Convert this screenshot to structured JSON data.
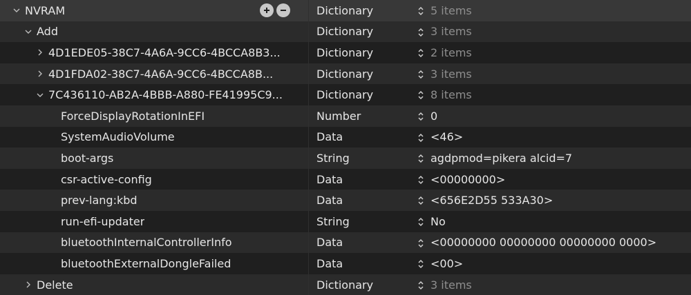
{
  "rows": [
    {
      "key": "NVRAM",
      "type": "Dictionary",
      "value": "5 items",
      "level": 0,
      "disclosure": "open",
      "controls": true,
      "dim": true,
      "style": "sel"
    },
    {
      "key": "Add",
      "type": "Dictionary",
      "value": "3 items",
      "level": 1,
      "disclosure": "open",
      "dim": true,
      "style": "alt"
    },
    {
      "key": "4D1EDE05-38C7-4A6A-9CC6-4BCCA8B3...",
      "type": "Dictionary",
      "value": "2 items",
      "level": 2,
      "disclosure": "closed",
      "dim": true,
      "style": ""
    },
    {
      "key": "4D1FDA02-38C7-4A6A-9CC6-4BCCA8B...",
      "type": "Dictionary",
      "value": "3 items",
      "level": 2,
      "disclosure": "closed",
      "dim": true,
      "style": "alt"
    },
    {
      "key": "7C436110-AB2A-4BBB-A880-FE41995C9...",
      "type": "Dictionary",
      "value": "8 items",
      "level": 2,
      "disclosure": "open",
      "dim": true,
      "style": ""
    },
    {
      "key": "ForceDisplayRotationInEFI",
      "type": "Number",
      "value": "0",
      "level": 3,
      "disclosure": "none",
      "dim": false,
      "style": "alt"
    },
    {
      "key": "SystemAudioVolume",
      "type": "Data",
      "value": "<46>",
      "level": 3,
      "disclosure": "none",
      "dim": false,
      "style": ""
    },
    {
      "key": "boot-args",
      "type": "String",
      "value": "agdpmod=pikera alcid=7",
      "level": 3,
      "disclosure": "none",
      "dim": false,
      "style": "alt"
    },
    {
      "key": "csr-active-config",
      "type": "Data",
      "value": "<00000000>",
      "level": 3,
      "disclosure": "none",
      "dim": false,
      "style": ""
    },
    {
      "key": "prev-lang:kbd",
      "type": "Data",
      "value": "<656E2D55 533A30>",
      "level": 3,
      "disclosure": "none",
      "dim": false,
      "style": "alt"
    },
    {
      "key": "run-efi-updater",
      "type": "String",
      "value": "No",
      "level": 3,
      "disclosure": "none",
      "dim": false,
      "style": ""
    },
    {
      "key": "bluetoothInternalControllerInfo",
      "type": "Data",
      "value": "<00000000 00000000 00000000 0000>",
      "level": 3,
      "disclosure": "none",
      "dim": false,
      "style": "alt"
    },
    {
      "key": "bluetoothExternalDongleFailed",
      "type": "Data",
      "value": "<00>",
      "level": 3,
      "disclosure": "none",
      "dim": false,
      "style": ""
    },
    {
      "key": "Delete",
      "type": "Dictionary",
      "value": "3 items",
      "level": 1,
      "disclosure": "closed",
      "dim": true,
      "style": "alt"
    }
  ],
  "icons": {
    "disclosure_open": "chevron-down-icon",
    "disclosure_closed": "chevron-right-icon",
    "add": "plus-circle-icon",
    "remove": "minus-circle-icon",
    "stepper": "up-down-arrows-icon"
  },
  "colors": {
    "background": "#1f1f1f",
    "row_alt": "#2b2b2b",
    "row_selected": "#383838",
    "text": "#e6e6e6",
    "text_dim": "#8e8e8e"
  }
}
